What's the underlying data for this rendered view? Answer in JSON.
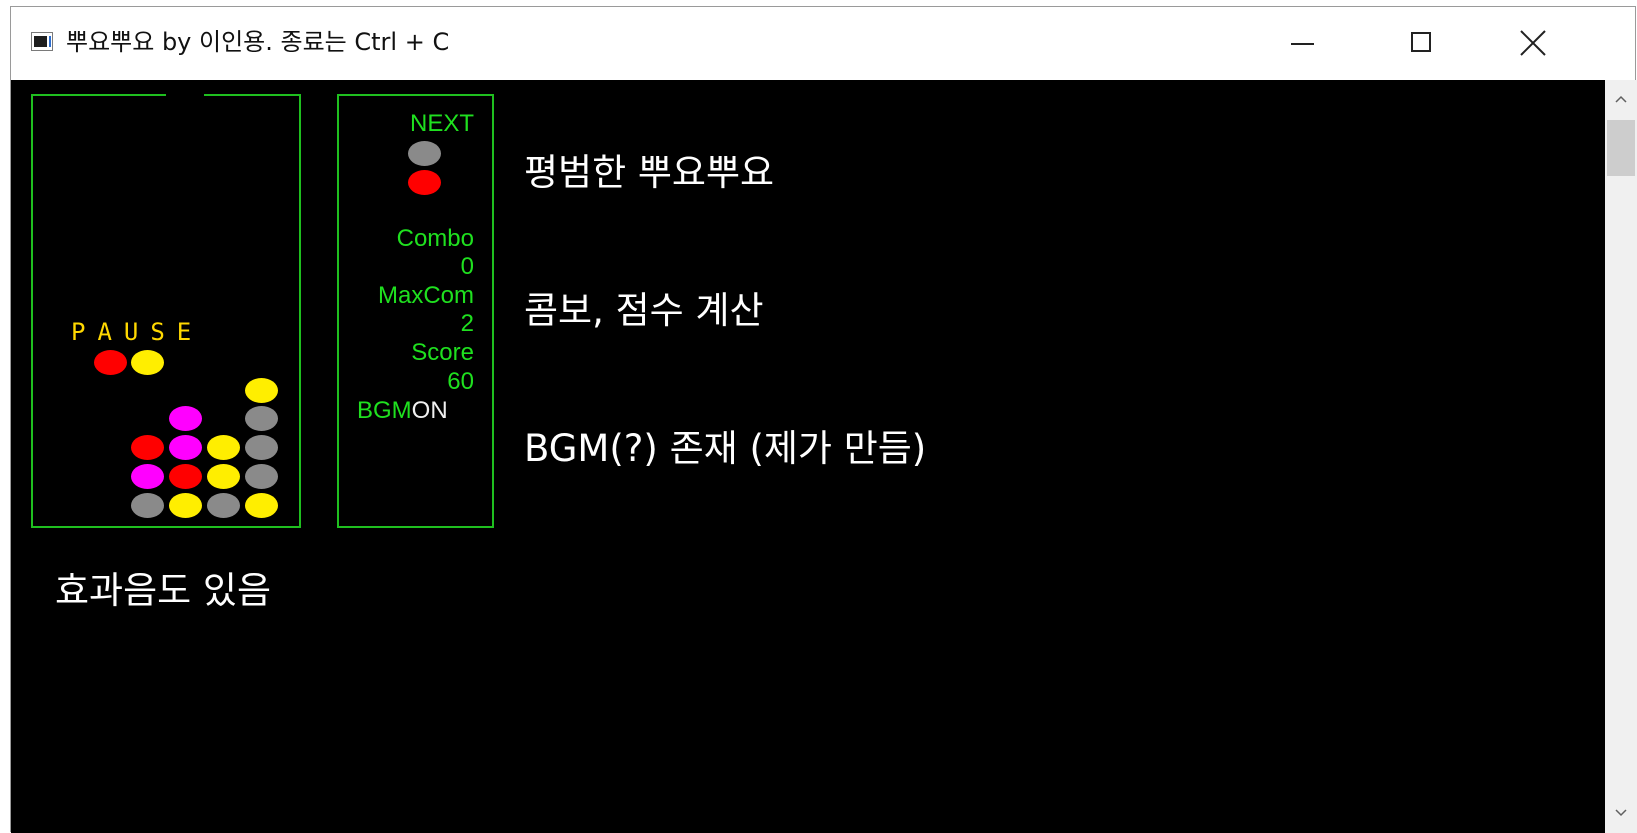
{
  "window": {
    "title": "뿌요뿌요 by 이인용. 종료는 Ctrl + C",
    "icons": {
      "app": "console-app-icon",
      "minimize": "minimize-icon",
      "maximize": "maximize-icon",
      "close": "close-icon"
    }
  },
  "game": {
    "pause_text": "PAUSE",
    "colors": {
      "red": "#ff0000",
      "yellow": "#ffee00",
      "magenta": "#ff00ff",
      "gray": "#8a8a8a",
      "frame": "#1fbf1f",
      "panel_text": "#1fe01f"
    },
    "panel": {
      "next_label": "NEXT",
      "next_pieces": [
        "gray",
        "red"
      ],
      "combo_label": "Combo",
      "combo_value": "0",
      "maxcombo_label": "MaxCom",
      "maxcombo_value": "2",
      "score_label": "Score",
      "score_value": "60",
      "bgm_label": "BGM",
      "bgm_value": "ON"
    }
  },
  "annotations": {
    "line1": "평범한 뿌요뿌요",
    "line2": "콤보, 점수 계산",
    "line3": "BGM(?) 존재 (제가 만듬)",
    "line4": "효과음도 있음"
  }
}
